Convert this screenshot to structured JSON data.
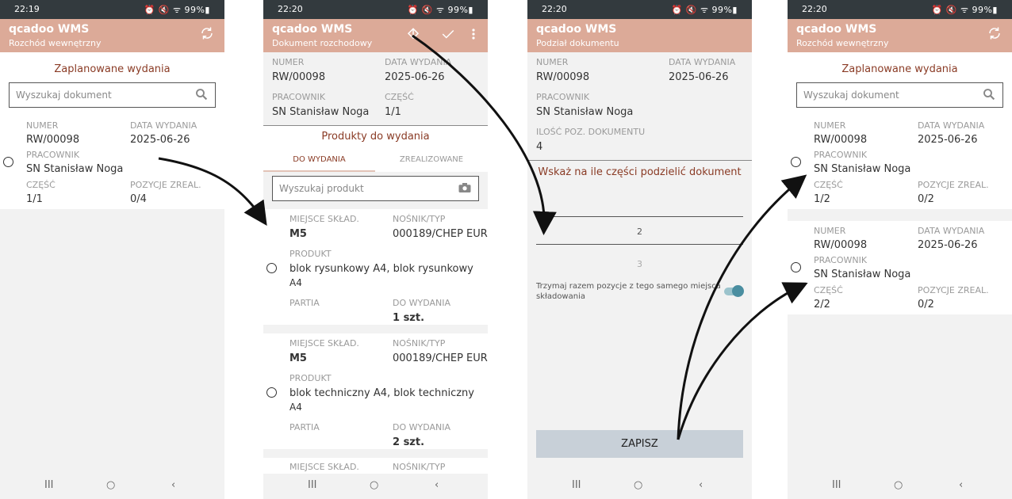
{
  "screens": [
    {
      "time": "22:19",
      "status_icons": "⏰ 🔇 ᯤ 99%▮",
      "app_title": "qcadoo WMS",
      "subtitle": "Rozchód wewnętrzny",
      "section_title": "Zaplanowane wydania",
      "search_placeholder": "Wyszukaj dokument",
      "documents": [
        {
          "numer_label": "NUMER",
          "numer": "RW/00098",
          "data_label": "DATA WYDANIA",
          "data": "2025-06-26",
          "pracownik_label": "PRACOWNIK",
          "pracownik": "SN Stanisław Noga",
          "czesc_label": "CZĘŚĆ",
          "czesc": "1/1",
          "pozycje_label": "POZYCJE ZREAL.",
          "pozycje": "0/4"
        }
      ]
    },
    {
      "time": "22:20",
      "status_icons": "⏰ 🔇 ᯤ 99%▮",
      "app_title": "qcadoo WMS",
      "subtitle": "Dokument rozchodowy",
      "numer_label": "NUMER",
      "numer": "RW/00098",
      "data_label": "DATA WYDANIA",
      "data": "2025-06-26",
      "pracownik_label": "PRACOWNIK",
      "pracownik": "SN Stanisław Noga",
      "czesc_label": "CZĘŚĆ",
      "czesc": "1/1",
      "section_title": "Produkty do wydania",
      "tabs": [
        "DO WYDANIA",
        "ZREALIZOWANE"
      ],
      "search_placeholder": "Wyszukaj produkt",
      "products": [
        {
          "miejsce_label": "MIEJSCE SKŁAD.",
          "miejsce": "M5",
          "nosnik_label": "NOŚNIK/TYP",
          "nosnik": "000189/CHEP EUR",
          "produkt_label": "PRODUKT",
          "produkt_line1": "blok rysunkowy A4, blok rysunkowy",
          "produkt_line2": "A4",
          "partia_label": "PARTIA",
          "do_wydania_label": "DO WYDANIA",
          "do_wydania": "1 szt."
        },
        {
          "miejsce_label": "MIEJSCE SKŁAD.",
          "miejsce": "M5",
          "nosnik_label": "NOŚNIK/TYP",
          "nosnik": "000189/CHEP EUR",
          "produkt_label": "PRODUKT",
          "produkt_line1": "blok techniczny A4, blok techniczny",
          "produkt_line2": "A4",
          "partia_label": "PARTIA",
          "do_wydania_label": "DO WYDANIA",
          "do_wydania": "2 szt."
        },
        {
          "miejsce_label": "MIEJSCE SKŁAD.",
          "nosnik_label": "NOŚNIK/TYP"
        }
      ]
    },
    {
      "time": "22:20",
      "status_icons": "⏰ 🔇 ᯤ 99%▮",
      "app_title": "qcadoo WMS",
      "subtitle": "Podział dokumentu",
      "numer_label": "NUMER",
      "numer": "RW/00098",
      "data_label": "DATA WYDANIA",
      "data": "2025-06-26",
      "pracownik_label": "PRACOWNIK",
      "pracownik": "SN Stanisław Noga",
      "ilosc_label": "ILOŚĆ POZ. DOKUMENTU",
      "ilosc": "4",
      "prompt": "Wskaż na ile części podzielić dokument",
      "picker_options": [
        "2",
        "3"
      ],
      "picker_selected": "2",
      "toggle_label_line1": "Trzymaj razem pozycje z tego samego miejsca",
      "toggle_label_line2": "składowania",
      "toggle_on": true,
      "save_label": "ZAPISZ"
    },
    {
      "time": "22:20",
      "status_icons": "⏰ 🔇 ᯤ 99%▮",
      "app_title": "qcadoo WMS",
      "subtitle": "Rozchód wewnętrzny",
      "section_title": "Zaplanowane wydania",
      "search_placeholder": "Wyszukaj dokument",
      "documents": [
        {
          "numer_label": "NUMER",
          "numer": "RW/00098",
          "data_label": "DATA WYDANIA",
          "data": "2025-06-26",
          "pracownik_label": "PRACOWNIK",
          "pracownik": "SN Stanisław Noga",
          "czesc_label": "CZĘŚĆ",
          "czesc": "1/2",
          "pozycje_label": "POZYCJE ZREAL.",
          "pozycje": "0/2"
        },
        {
          "numer_label": "NUMER",
          "numer": "RW/00098",
          "data_label": "DATA WYDANIA",
          "data": "2025-06-26",
          "pracownik_label": "PRACOWNIK",
          "pracownik": "SN Stanisław Noga",
          "czesc_label": "CZĘŚĆ",
          "czesc": "2/2",
          "pozycje_label": "POZYCJE ZREAL.",
          "pozycje": "0/2"
        }
      ]
    }
  ],
  "navbar": {
    "recent": "III",
    "home": "○",
    "back": "‹"
  }
}
